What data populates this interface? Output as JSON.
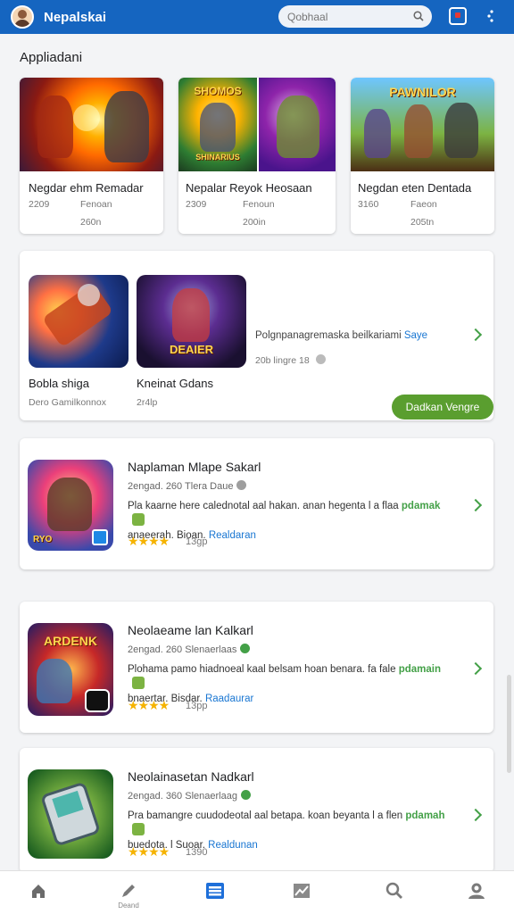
{
  "header": {
    "app_title": "Nepalskai",
    "search_placeholder": "Qobhaal"
  },
  "section_title": "Appliadani",
  "featured": [
    {
      "title": "Negdar ehm Remadar",
      "meta_left": "2209",
      "meta_right": "Fenoan",
      "meta_sub": "260n",
      "art_caption": ""
    },
    {
      "title": "Nepalar Reyok Heosaan",
      "meta_left": "2309",
      "meta_right": "Fenoun",
      "meta_sub": "200in",
      "art_caption": "SHOMOS",
      "art_caption2": "SHINARIUS"
    },
    {
      "title": "Negdan eten Dentada",
      "meta_left": "3160",
      "meta_right": "Faeon",
      "meta_sub": "205tn",
      "art_caption": "PAWNILOR"
    }
  ],
  "promo": {
    "item1_title": "Bobla shiga",
    "item1_meta": "Dero Gamilkonnox",
    "item2_title": "Kneinat Gdans",
    "item2_meta": "2r4lp",
    "item2_art_caption": "DEAIER",
    "desc": "Polgnpanagremaska beilkariami",
    "desc_link": "Saye",
    "meta": "20b lingre 18",
    "cta_label": "Dadkan Vengre"
  },
  "apps": [
    {
      "title": "Naplaman Mlape Sakarl",
      "meta": "2engad. 260 Tlera Daue",
      "desc1": "Pla kaarne here calednotal aal hakan. anan hegenta l a flaa",
      "desc1_tag": "pdamak",
      "desc2": "anaeerah. Bioan.",
      "desc2_link": "Realdaran",
      "stars": "★★★★",
      "rating": "13gp",
      "art_caption": "RYO"
    },
    {
      "title": "Neolaeame lan Kalkarl",
      "meta": "2engad. 260 Slenaerlaas",
      "desc1": "Plohama pamo hiadnoeal kaal belsam hoan benara. fa fale",
      "desc1_tag": "pdamain",
      "desc2": "bnaertar. Bisdar.",
      "desc2_link": "Raadaurar",
      "stars": "★★★★",
      "rating": "13pp",
      "art_caption": "ARDENK"
    },
    {
      "title": "Neolainasetan Nadkarl",
      "meta": "2engad. 360 Slenaerlaag",
      "desc1": "Pra bamangre cuudodeotal aal betapa. koan beyanta l a flen",
      "desc1_tag": "pdamah",
      "desc2": "buedota. l Suoar.",
      "desc2_link": "Realdunan",
      "stars": "★★★★",
      "rating": "1390",
      "art_caption": ""
    }
  ],
  "bottom_nav": [
    {
      "icon": "home-icon",
      "label": ""
    },
    {
      "icon": "pen-icon",
      "label": "Deand"
    },
    {
      "icon": "list-icon",
      "label": ""
    },
    {
      "icon": "chart-icon",
      "label": ""
    },
    {
      "icon": "search-icon",
      "label": ""
    },
    {
      "icon": "account-icon",
      "label": ""
    }
  ],
  "colors": {
    "header_bg": "#1565c0",
    "accent_green": "#5a9e2f",
    "link_blue": "#1976d2",
    "star_gold": "#f5b301",
    "nav_active": "#1e6fd9"
  }
}
